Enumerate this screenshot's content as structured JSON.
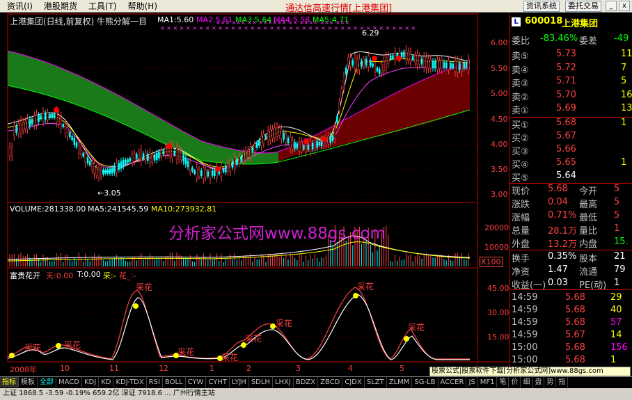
{
  "menu": [
    "资讯(I)",
    "港股期货",
    "工具(T)",
    "帮助(H)"
  ],
  "app_title": "通达信高速行情[上港集团]",
  "top_buttons": [
    "资讯系统",
    "委托交易"
  ],
  "window_buttons": [
    "_",
    "□",
    "x"
  ],
  "main_chart": {
    "title": "上港集团(日线,前复权) 牛熊分解一目",
    "ma": [
      {
        "label": "MA1:5.60",
        "color": "#ffffff"
      },
      {
        "label": "MA2:5.61",
        "color": "#ffff00"
      },
      {
        "label": "MA3:5.64",
        "color": "#ff00ff"
      },
      {
        "label": "MA4:5.58",
        "color": "#00ff00"
      },
      {
        "label": "MA5:4.71",
        "color": "#ff4040"
      }
    ],
    "y_ticks": [
      "6.00",
      "5.50",
      "5.00",
      "4.50",
      "4.00",
      "3.50",
      "3.00"
    ],
    "high_label": "6.29",
    "low_label": "←3.05"
  },
  "volume_chart": {
    "labels": [
      {
        "text": "VOLUME:281338.00",
        "color": "#ffffff"
      },
      {
        "text": "MA5:241545.59",
        "color": "#ffffff"
      },
      {
        "text": "MA10:273932.81",
        "color": "#ffff00"
      }
    ],
    "y_ticks": [
      "20000",
      "10000"
    ],
    "unit": "X100"
  },
  "indicator_chart": {
    "title": "富贵花开",
    "labels": [
      {
        "text": "天:0.00",
        "color": "#ff4040"
      },
      {
        "text": "T:0.00",
        "color": "#ffffff"
      },
      {
        "text": "采:-",
        "color": "#ffff00"
      },
      {
        "text": "花_:-",
        "color": "#ff4040"
      }
    ],
    "y_ticks": [
      "45.00",
      "30.00",
      "15.00"
    ],
    "marker_text": "采花"
  },
  "x_axis": [
    "2008年",
    "10",
    "11",
    "12",
    "1",
    "2",
    "3",
    "4",
    "5"
  ],
  "watermark": "分析家公式网www.88gs.com",
  "quote": {
    "code": "600018",
    "name": "上港集团",
    "wb_label": "委比",
    "wb_value": "-83.46%",
    "wc_label": "委差",
    "wc_value": "-49",
    "asks": [
      {
        "label": "卖⑤",
        "price": "5.73",
        "vol": "11"
      },
      {
        "label": "卖④",
        "price": "5.72",
        "vol": "7"
      },
      {
        "label": "卖③",
        "price": "5.71",
        "vol": "5"
      },
      {
        "label": "卖②",
        "price": "5.70",
        "vol": "16"
      },
      {
        "label": "卖①",
        "price": "5.69",
        "vol": "13"
      }
    ],
    "bids": [
      {
        "label": "买①",
        "price": "5.68",
        "vol": "1"
      },
      {
        "label": "买②",
        "price": "5.67",
        "vol": ""
      },
      {
        "label": "买③",
        "price": "5.66",
        "vol": ""
      },
      {
        "label": "买④",
        "price": "5.65",
        "vol": "1"
      },
      {
        "label": "买⑤",
        "price": "5.64",
        "vol": ""
      }
    ],
    "stats": [
      {
        "l1": "现价",
        "v1": "5.68",
        "l2": "今开",
        "v2": "5"
      },
      {
        "l1": "涨跌",
        "v1": "0.04",
        "l2": "最高",
        "v2": "5"
      },
      {
        "l1": "涨幅",
        "v1": "0.71%",
        "l2": "最低",
        "v2": "5"
      },
      {
        "l1": "总量",
        "v1": "28.1万",
        "l2": "量比",
        "v2": "1"
      },
      {
        "l1": "外盘",
        "v1": "13.2万",
        "l2": "内盘",
        "v2": "15."
      }
    ],
    "stats2": [
      {
        "l1": "换手",
        "v1": "0.35%",
        "l2": "股本",
        "v2": "21"
      },
      {
        "l1": "净资",
        "v1": "1.47",
        "l2": "流通",
        "v2": "79"
      },
      {
        "l1": "收益(一)",
        "v1": "0.03",
        "l2": "PE(动)",
        "v2": "1"
      }
    ],
    "ticks": [
      {
        "t": "14:59",
        "p": "5.68",
        "v": "29"
      },
      {
        "t": "14:59",
        "p": "5.68",
        "v": "40"
      },
      {
        "t": "14:59",
        "p": "5.68",
        "v": "57"
      },
      {
        "t": "14:59",
        "p": "5.67",
        "v": "14"
      },
      {
        "t": "15:00",
        "p": "5.68",
        "v": "156"
      },
      {
        "t": "15:00",
        "p": "5.68",
        "v": "1"
      }
    ]
  },
  "ad": "股票公式|股票软件下载[分析家公式网]www.88gs.com",
  "bottom_tabs": [
    "指标",
    "模板",
    "全部",
    "MACD",
    "KDJ",
    "KD",
    "KDJ-TDX",
    "RSI",
    "BOLL",
    "CYW",
    "CYHT",
    "LYJH",
    "SDLH",
    "LHXJ",
    "BDZX",
    "ZBCD",
    "CJDX",
    "SLZT",
    "ZLMM",
    "SG-LB",
    "ACCER",
    "JS",
    "MF1"
  ],
  "right_tabs": [
    "笔",
    "价",
    "细",
    "盘",
    "势",
    "指"
  ],
  "status": "上证 1868.5  -3.59  -0.19%  659.2亿  深证 7918.6 ... 广州行情主站"
}
